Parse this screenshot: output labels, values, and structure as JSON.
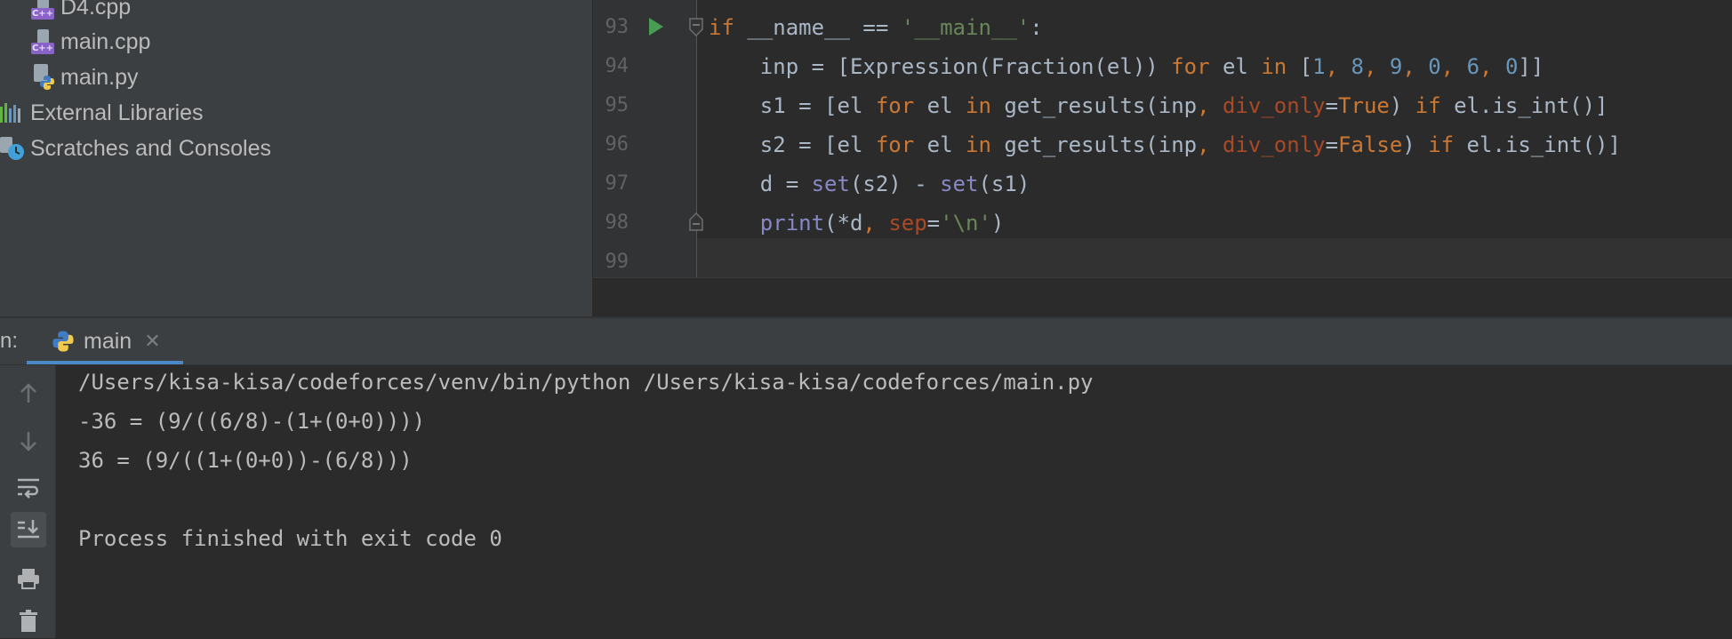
{
  "project": {
    "items": [
      {
        "label": "D4.cpp",
        "icon": "cpp-file-icon"
      },
      {
        "label": "main.cpp",
        "icon": "cpp-file-icon"
      },
      {
        "label": "main.py",
        "icon": "python-file-icon"
      },
      {
        "label": "External Libraries",
        "icon": "libraries-icon"
      },
      {
        "label": "Scratches and Consoles",
        "icon": "scratches-icon"
      }
    ],
    "cpp_badge": "C++"
  },
  "editor": {
    "line_numbers": [
      "93",
      "94",
      "95",
      "96",
      "97",
      "98",
      "99"
    ],
    "code": [
      [
        {
          "t": "if",
          "c": "kw"
        },
        {
          "t": " __name__ == ",
          "c": ""
        },
        {
          "t": "'__main__'",
          "c": "str"
        },
        {
          "t": ":",
          "c": ""
        }
      ],
      [
        {
          "t": "    inp = [Expression(Fraction(el)) ",
          "c": ""
        },
        {
          "t": "for",
          "c": "kw"
        },
        {
          "t": " el ",
          "c": ""
        },
        {
          "t": "in",
          "c": "kw"
        },
        {
          "t": " [",
          "c": ""
        },
        {
          "t": "1",
          "c": "num"
        },
        {
          "t": ", ",
          "c": "kw"
        },
        {
          "t": "8",
          "c": "num"
        },
        {
          "t": ", ",
          "c": "kw"
        },
        {
          "t": "9",
          "c": "num"
        },
        {
          "t": ", ",
          "c": "kw"
        },
        {
          "t": "0",
          "c": "num"
        },
        {
          "t": ", ",
          "c": "kw"
        },
        {
          "t": "6",
          "c": "num"
        },
        {
          "t": ", ",
          "c": "kw"
        },
        {
          "t": "0",
          "c": "num"
        },
        {
          "t": "]]",
          "c": ""
        }
      ],
      [
        {
          "t": "    s1 = [el ",
          "c": ""
        },
        {
          "t": "for",
          "c": "kw"
        },
        {
          "t": " el ",
          "c": ""
        },
        {
          "t": "in",
          "c": "kw"
        },
        {
          "t": " get_results(inp",
          "c": ""
        },
        {
          "t": ", ",
          "c": "kw"
        },
        {
          "t": "div_only",
          "c": "param"
        },
        {
          "t": "=",
          "c": ""
        },
        {
          "t": "True",
          "c": "kw"
        },
        {
          "t": ") ",
          "c": ""
        },
        {
          "t": "if",
          "c": "kw"
        },
        {
          "t": " el.is_int()]",
          "c": ""
        }
      ],
      [
        {
          "t": "    s2 = [el ",
          "c": ""
        },
        {
          "t": "for",
          "c": "kw"
        },
        {
          "t": " el ",
          "c": ""
        },
        {
          "t": "in",
          "c": "kw"
        },
        {
          "t": " get_results(inp",
          "c": ""
        },
        {
          "t": ", ",
          "c": "kw"
        },
        {
          "t": "div_only",
          "c": "param"
        },
        {
          "t": "=",
          "c": ""
        },
        {
          "t": "False",
          "c": "kw"
        },
        {
          "t": ") ",
          "c": ""
        },
        {
          "t": "if",
          "c": "kw"
        },
        {
          "t": " el.is_int()]",
          "c": ""
        }
      ],
      [
        {
          "t": "    d = ",
          "c": ""
        },
        {
          "t": "set",
          "c": "bi"
        },
        {
          "t": "(s2) - ",
          "c": ""
        },
        {
          "t": "set",
          "c": "bi"
        },
        {
          "t": "(s1)",
          "c": ""
        }
      ],
      [
        {
          "t": "    ",
          "c": ""
        },
        {
          "t": "print",
          "c": "bi"
        },
        {
          "t": "(*d",
          "c": ""
        },
        {
          "t": ", ",
          "c": "kw"
        },
        {
          "t": "sep",
          "c": "param"
        },
        {
          "t": "=",
          "c": ""
        },
        {
          "t": "'\\n'",
          "c": "str"
        },
        {
          "t": ")",
          "c": ""
        }
      ],
      []
    ]
  },
  "run": {
    "label": "n:",
    "tab_label": "main",
    "close_glyph": "✕",
    "console": [
      "/Users/kisa-kisa/codeforces/venv/bin/python /Users/kisa-kisa/codeforces/main.py",
      "-36 = (9/((6/8)-(1+(0+0))))",
      "36 = (9/((1+(0+0))-(6/8)))",
      "",
      "Process finished with exit code 0"
    ],
    "toolbar": [
      "arrow-up-icon",
      "arrow-down-icon",
      "soft-wrap-icon",
      "scroll-to-end-icon",
      "print-icon",
      "trash-icon"
    ]
  },
  "colors": {
    "keyword": "#cc7832",
    "string": "#6a8759",
    "number": "#6897bb",
    "builtin": "#8888c6",
    "param": "#aa4926",
    "run_arrow": "#499c54",
    "tab_underline": "#4a88c7"
  }
}
